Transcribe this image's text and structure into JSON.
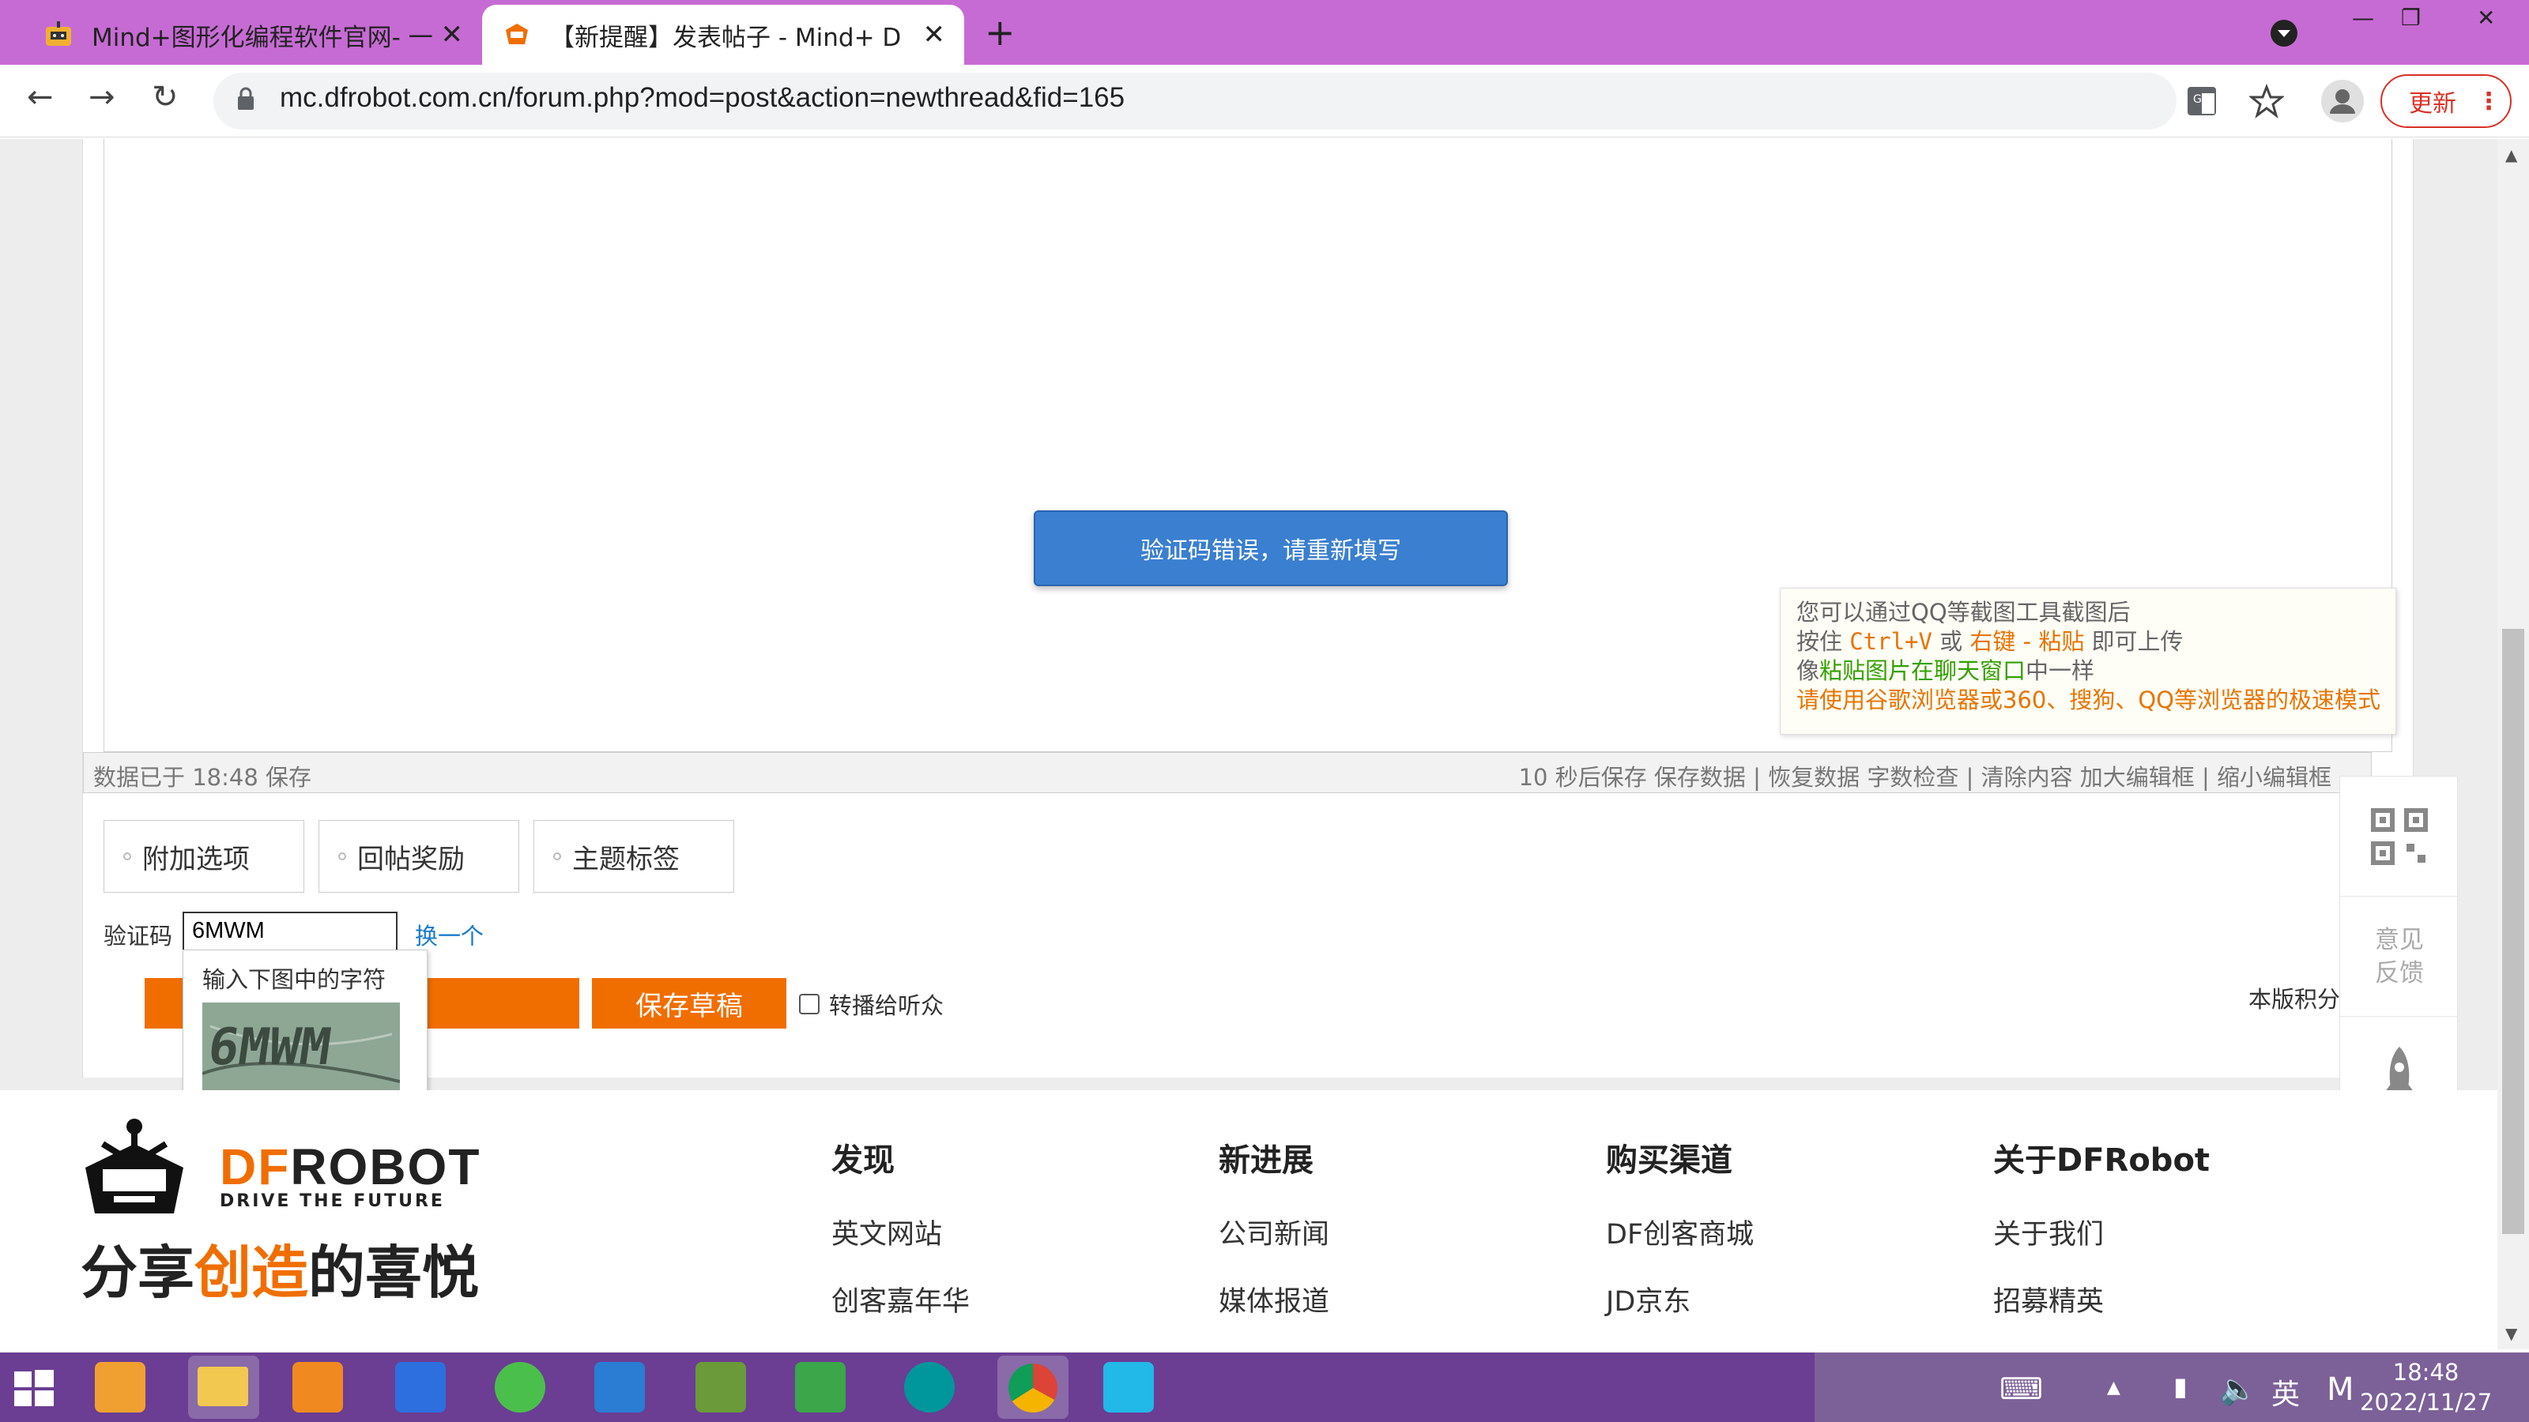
{
  "browser": {
    "tabs": [
      {
        "title": "Mind+图形化编程软件官网- 一站"
      },
      {
        "title": "【新提醒】发表帖子 - Mind+ D"
      }
    ],
    "url": "mc.dfrobot.com.cn/forum.php?mod=post&action=newthread&fid=165",
    "update_label": "更新"
  },
  "editor": {
    "error_message": "验证码错误，请重新填写",
    "saved_status": "数据已于 18:48 保存",
    "edit_links": "10 秒后保存 保存数据 | 恢复数据    字数检查 | 清除内容    加大编辑框 | 缩小编辑框",
    "tip": {
      "line1": "您可以通过QQ等截图工具截图后",
      "line2_a": "按住 ",
      "line2_b": "Ctrl+V",
      "line2_c": " 或 ",
      "line2_d": "右键 - 粘贴",
      "line2_e": " 即可上传",
      "line3_a": "像",
      "line3_b": "粘贴图片在聊天窗口",
      "line3_c": "中一样",
      "line4": "请使用谷歌浏览器或360、搜狗、QQ等浏览器的极速模式"
    }
  },
  "options": [
    "附加选项",
    "回帖奖励",
    "主题标签"
  ],
  "captcha": {
    "label": "验证码",
    "value": "6MWM",
    "change": "换一个",
    "hint": "输入下图中的字符",
    "image_text": "6MWM"
  },
  "actions": {
    "save_draft": "保存草稿",
    "broadcast": "转播给听众",
    "rules": "本版积分规则"
  },
  "side_float": {
    "feedback_1": "意见",
    "feedback_2": "反馈"
  },
  "footer": {
    "brand": {
      "df": "DF",
      "robot": "ROBOT",
      "tagline": "DRIVE THE FUTURE",
      "slogan_a": "分享",
      "slogan_b": "创造",
      "slogan_c": "的喜悦"
    },
    "columns": [
      {
        "title": "发现",
        "links": [
          "英文网站",
          "创客嘉年华"
        ]
      },
      {
        "title": "新进展",
        "links": [
          "公司新闻",
          "媒体报道"
        ]
      },
      {
        "title": "购买渠道",
        "links": [
          "DF创客商城",
          "JD京东"
        ]
      },
      {
        "title": "关于DFRobot",
        "links": [
          "关于我们",
          "招募精英"
        ]
      }
    ]
  },
  "taskbar": {
    "ime": "英",
    "ime_mode": "M",
    "time": "18:48",
    "date": "2022/11/27"
  }
}
